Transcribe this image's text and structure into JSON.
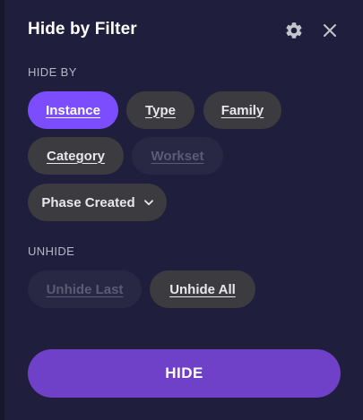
{
  "header": {
    "title": "Hide by Filter",
    "settings_icon": "gear-icon",
    "close_icon": "close-icon"
  },
  "hide_by": {
    "label": "HIDE BY",
    "chips": [
      {
        "label": "Instance",
        "state": "active"
      },
      {
        "label": "Type",
        "state": "normal"
      },
      {
        "label": "Family",
        "state": "normal"
      },
      {
        "label": "Category",
        "state": "normal"
      },
      {
        "label": "Workset",
        "state": "disabled"
      },
      {
        "label": "Phase Created",
        "state": "normal",
        "dropdown_icon": "chevron-down-icon"
      }
    ]
  },
  "unhide": {
    "label": "UNHIDE",
    "buttons": [
      {
        "label": "Unhide Last",
        "state": "disabled"
      },
      {
        "label": "Unhide All",
        "state": "normal"
      }
    ]
  },
  "primary_action": {
    "label": "HIDE"
  },
  "colors": {
    "background": "#1f1f3d",
    "accent": "#7c4dff",
    "primary_button": "#6f41c8",
    "chip": "#3b3b40",
    "chip_disabled": "#282844"
  }
}
